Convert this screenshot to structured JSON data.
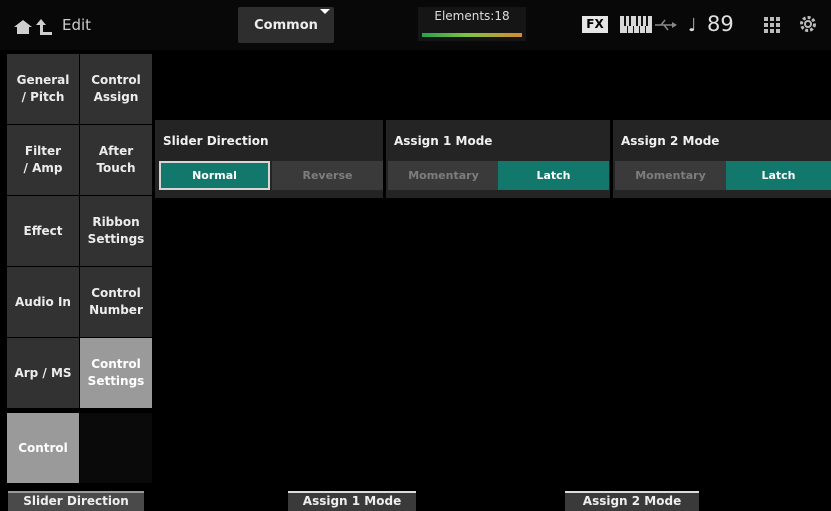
{
  "header": {
    "edit_label": "Edit",
    "part_selector": "Common",
    "elements_label": "Elements:18",
    "fx_badge": "FX",
    "tempo": "89",
    "icons": [
      "home-icon",
      "up-arrow-icon",
      "keyboard-icon",
      "usb-icon",
      "note-icon",
      "grid-icon",
      "gear-icon"
    ]
  },
  "left_tabs": [
    {
      "label": "General\n/ Pitch",
      "selected": false
    },
    {
      "label": "Filter\n/ Amp",
      "selected": false
    },
    {
      "label": "Effect",
      "selected": false
    },
    {
      "label": "Audio In",
      "selected": false
    },
    {
      "label": "Arp / MS",
      "selected": false
    },
    {
      "label": "Control",
      "selected": true
    }
  ],
  "sub_tabs": [
    {
      "label": "Control\nAssign",
      "selected": false
    },
    {
      "label": "After\nTouch",
      "selected": false
    },
    {
      "label": "Ribbon\nSettings",
      "selected": false
    },
    {
      "label": "Control\nNumber",
      "selected": false
    },
    {
      "label": "Control\nSettings",
      "selected": true
    }
  ],
  "panels": [
    {
      "title": "Slider Direction",
      "options": [
        "Normal",
        "Reverse"
      ],
      "selected": "Normal"
    },
    {
      "title": "Assign 1 Mode",
      "options": [
        "Momentary",
        "Latch"
      ],
      "selected": "Latch"
    },
    {
      "title": "Assign 2 Mode",
      "options": [
        "Momentary",
        "Latch"
      ],
      "selected": "Latch"
    }
  ],
  "bottom_labels": [
    "Slider Direction",
    "Assign 1 Mode",
    "Assign 2 Mode"
  ],
  "colors": {
    "selected_option": "#12786b",
    "selected_tab": "#9a9a9a"
  }
}
